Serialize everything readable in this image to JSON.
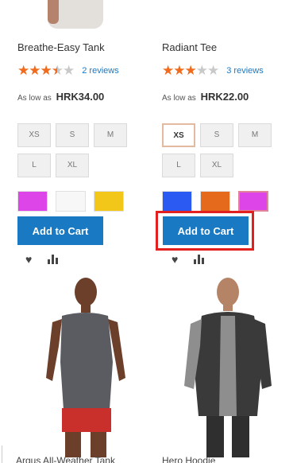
{
  "products": [
    {
      "name": "Breathe-Easy Tank",
      "stars": 3.5,
      "reviews": "2 reviews",
      "price_prefix": "As low as",
      "price": "HRK34.00",
      "sizes": [
        "XS",
        "S",
        "M",
        "L",
        "XL"
      ],
      "selected_size": null,
      "colors": [
        "#dd45e8",
        "#f7f7f7",
        "#f3c61a"
      ],
      "add_to_cart": "Add to Cart"
    },
    {
      "name": "Radiant Tee",
      "stars": 3,
      "reviews": "3 reviews",
      "price_prefix": "As low as",
      "price": "HRK22.00",
      "sizes": [
        "XS",
        "S",
        "M",
        "L",
        "XL"
      ],
      "selected_size": "XS",
      "colors": [
        "#2a5af2",
        "#e56a1b",
        "#dd45e8"
      ],
      "selected_color": "#dd45e8",
      "add_to_cart": "Add to Cart"
    }
  ],
  "next_row": [
    {
      "name": "Argus All-Weather Tank"
    },
    {
      "name": "Hero Hoodie"
    }
  ],
  "accent_color": "#1979c3",
  "highlight_color": "#e22020"
}
